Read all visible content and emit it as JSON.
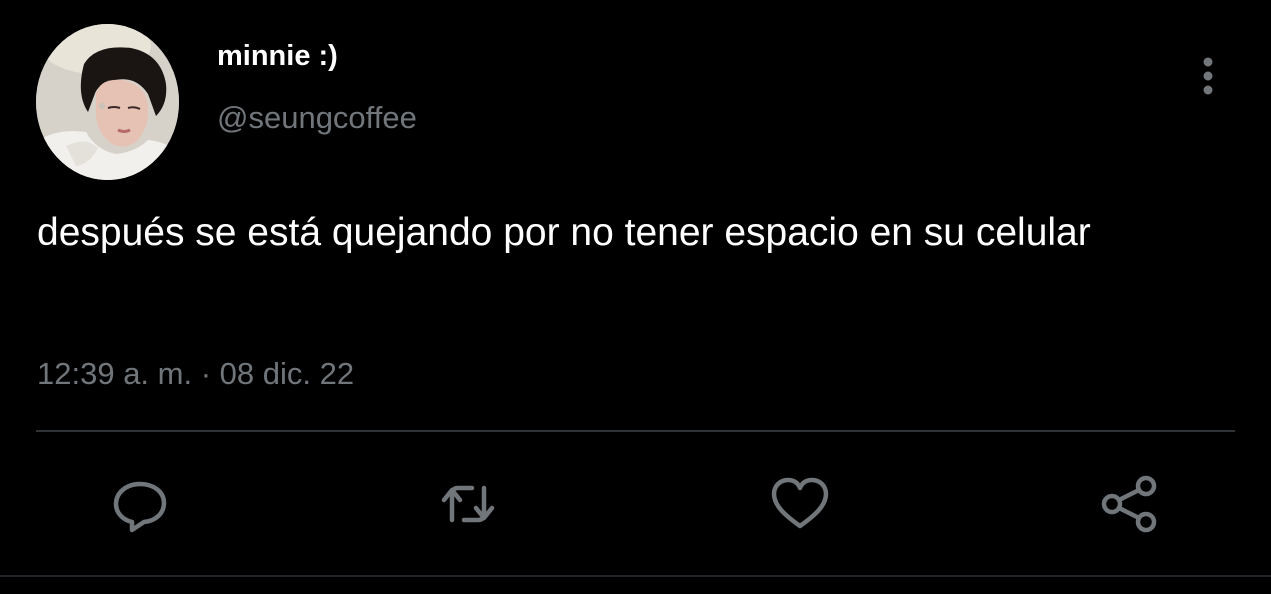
{
  "tweet": {
    "author_name": "minnie :)",
    "author_handle": "@seungcoffee",
    "text": "después se está quejando por no tener espacio en su celular",
    "timestamp": "12:39 a. m. · 08 dic. 22"
  },
  "icons": {
    "more": "more-vertical-icon",
    "reply": "reply-icon",
    "retweet": "retweet-icon",
    "like": "heart-icon",
    "share": "share-icon"
  },
  "colors": {
    "background": "#000000",
    "primary_text": "#ffffff",
    "secondary_text": "#71767b",
    "icon": "#71767b",
    "divider": "#2f3336"
  }
}
